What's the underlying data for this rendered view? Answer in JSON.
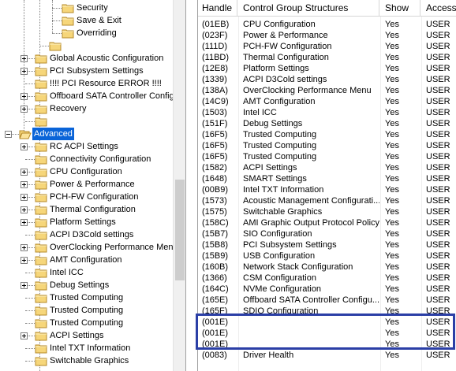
{
  "tree": {
    "items": [
      {
        "label": "Security",
        "expander": "",
        "selected": false
      },
      {
        "label": "Save & Exit",
        "expander": "",
        "selected": false
      },
      {
        "label": "Overriding",
        "expander": "",
        "selected": false
      },
      {
        "label": "",
        "expander": "",
        "selected": false
      },
      {
        "label": "Global Acoustic Configuration",
        "expander": "plus",
        "selected": false
      },
      {
        "label": "PCI Subsystem Settings",
        "expander": "plus",
        "selected": false
      },
      {
        "label": "!!!! PCI Resource ERROR !!!!",
        "expander": "",
        "selected": false
      },
      {
        "label": "Offboard SATA Controller Configu",
        "expander": "plus",
        "selected": false
      },
      {
        "label": "Recovery",
        "expander": "plus",
        "selected": false
      },
      {
        "label": "",
        "expander": "",
        "selected": false
      },
      {
        "label": "Advanced",
        "expander": "minus",
        "selected": true
      },
      {
        "label": "RC ACPI Settings",
        "expander": "plus",
        "selected": false
      },
      {
        "label": "Connectivity Configuration",
        "expander": "",
        "selected": false
      },
      {
        "label": "CPU Configuration",
        "expander": "plus",
        "selected": false
      },
      {
        "label": "Power & Performance",
        "expander": "plus",
        "selected": false
      },
      {
        "label": "PCH-FW Configuration",
        "expander": "plus",
        "selected": false
      },
      {
        "label": "Thermal Configuration",
        "expander": "plus",
        "selected": false
      },
      {
        "label": "Platform Settings",
        "expander": "plus",
        "selected": false
      },
      {
        "label": "ACPI D3Cold settings",
        "expander": "",
        "selected": false
      },
      {
        "label": "OverClocking Performance Menu",
        "expander": "plus",
        "selected": false
      },
      {
        "label": "AMT Configuration",
        "expander": "plus",
        "selected": false
      },
      {
        "label": "Intel ICC",
        "expander": "",
        "selected": false
      },
      {
        "label": "Debug Settings",
        "expander": "plus",
        "selected": false
      },
      {
        "label": "Trusted Computing",
        "expander": "",
        "selected": false
      },
      {
        "label": "Trusted Computing",
        "expander": "",
        "selected": false
      },
      {
        "label": "Trusted Computing",
        "expander": "",
        "selected": false
      },
      {
        "label": "ACPI Settings",
        "expander": "plus",
        "selected": false
      },
      {
        "label": "Intel TXT Information",
        "expander": "",
        "selected": false
      },
      {
        "label": "Switchable Graphics",
        "expander": "",
        "selected": false
      }
    ]
  },
  "table": {
    "columns": [
      "Handle",
      "Control Group Structures",
      "Show",
      "Access/"
    ],
    "rows": [
      {
        "handle": "(01EB)",
        "structure": "CPU Configuration",
        "show": "Yes",
        "access": "USER"
      },
      {
        "handle": "(023F)",
        "structure": "Power & Performance",
        "show": "Yes",
        "access": "USER"
      },
      {
        "handle": "(111D)",
        "structure": "PCH-FW Configuration",
        "show": "Yes",
        "access": "USER"
      },
      {
        "handle": "(11BD)",
        "structure": "Thermal Configuration",
        "show": "Yes",
        "access": "USER"
      },
      {
        "handle": "(12E8)",
        "structure": "Platform Settings",
        "show": "Yes",
        "access": "USER"
      },
      {
        "handle": "(1339)",
        "structure": "ACPI D3Cold settings",
        "show": "Yes",
        "access": "USER"
      },
      {
        "handle": "(138A)",
        "structure": "OverClocking Performance Menu",
        "show": "Yes",
        "access": "USER"
      },
      {
        "handle": "(14C9)",
        "structure": "AMT Configuration",
        "show": "Yes",
        "access": "USER"
      },
      {
        "handle": "(1503)",
        "structure": "Intel ICC",
        "show": "Yes",
        "access": "USER"
      },
      {
        "handle": "(151F)",
        "structure": "Debug Settings",
        "show": "Yes",
        "access": "USER"
      },
      {
        "handle": "(16F5)",
        "structure": "Trusted Computing",
        "show": "Yes",
        "access": "USER"
      },
      {
        "handle": "(16F5)",
        "structure": "Trusted Computing",
        "show": "Yes",
        "access": "USER"
      },
      {
        "handle": "(16F5)",
        "structure": "Trusted Computing",
        "show": "Yes",
        "access": "USER"
      },
      {
        "handle": "(1582)",
        "structure": "ACPI Settings",
        "show": "Yes",
        "access": "USER"
      },
      {
        "handle": "(1648)",
        "structure": "SMART Settings",
        "show": "Yes",
        "access": "USER"
      },
      {
        "handle": "(00B9)",
        "structure": "Intel TXT Information",
        "show": "Yes",
        "access": "USER"
      },
      {
        "handle": "(1573)",
        "structure": "Acoustic Management Configurati...",
        "show": "Yes",
        "access": "USER"
      },
      {
        "handle": "(1575)",
        "structure": "Switchable Graphics",
        "show": "Yes",
        "access": "USER"
      },
      {
        "handle": "(158C)",
        "structure": "AMI Graphic Output Protocol Policy",
        "show": "Yes",
        "access": "USER"
      },
      {
        "handle": "(15B7)",
        "structure": "SIO Configuration",
        "show": "Yes",
        "access": "USER"
      },
      {
        "handle": "(15B8)",
        "structure": "PCI Subsystem Settings",
        "show": "Yes",
        "access": "USER"
      },
      {
        "handle": "(15B9)",
        "structure": "USB Configuration",
        "show": "Yes",
        "access": "USER"
      },
      {
        "handle": "(160B)",
        "structure": "Network Stack Configuration",
        "show": "Yes",
        "access": "USER"
      },
      {
        "handle": "(1366)",
        "structure": "CSM Configuration",
        "show": "Yes",
        "access": "USER"
      },
      {
        "handle": "(164C)",
        "structure": "NVMe Configuration",
        "show": "Yes",
        "access": "USER"
      },
      {
        "handle": "(165E)",
        "structure": "Offboard SATA Controller Configu...",
        "show": "Yes",
        "access": "USER"
      },
      {
        "handle": "(165F)",
        "structure": "SDIO Configuration",
        "show": "Yes",
        "access": "USER"
      },
      {
        "handle": "(001E)",
        "structure": "",
        "show": "Yes",
        "access": "USER"
      },
      {
        "handle": "(001E)",
        "structure": "",
        "show": "Yes",
        "access": "USER"
      },
      {
        "handle": "(001E)",
        "structure": "",
        "show": "Yes",
        "access": "USER"
      },
      {
        "handle": "(0083)",
        "structure": "Driver Health",
        "show": "Yes",
        "access": "USER"
      }
    ]
  },
  "colors": {
    "selection": "#0a64d8",
    "highlight_box": "#2b3fa6",
    "folder_fill": "#f6d67a",
    "folder_edge": "#b58a2a"
  }
}
